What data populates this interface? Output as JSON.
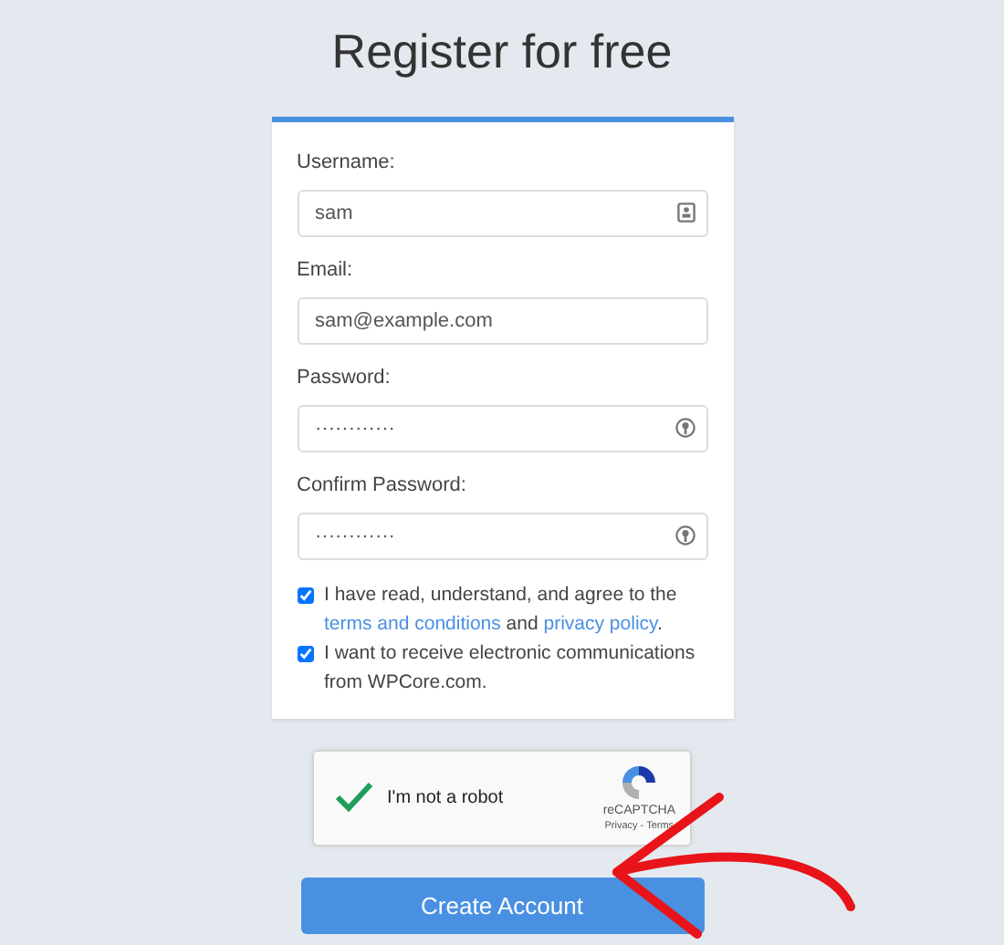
{
  "title": "Register for free",
  "fields": [
    {
      "label": "Username:",
      "value": "sam",
      "kind": "username"
    },
    {
      "label": "Email:",
      "value": "sam@example.com",
      "kind": "email"
    },
    {
      "label": "Password:",
      "value": "············",
      "kind": "password"
    },
    {
      "label": "Confirm Password:",
      "value": "············",
      "kind": "password"
    }
  ],
  "checks": [
    {
      "checked": true,
      "parts": [
        {
          "text": "I have read, understand, and agree to the "
        },
        {
          "text": "terms and conditions",
          "link": true
        },
        {
          "text": " and "
        },
        {
          "text": "privacy policy",
          "link": true
        },
        {
          "text": "."
        }
      ]
    },
    {
      "checked": true,
      "parts": [
        {
          "text": "I want to receive electronic communications from WPCore.com."
        }
      ]
    }
  ],
  "captcha": {
    "checked": true,
    "label": "I'm not a robot",
    "brand": "reCAPTCHA",
    "links": "Privacy - Terms"
  },
  "submit": "Create Account"
}
